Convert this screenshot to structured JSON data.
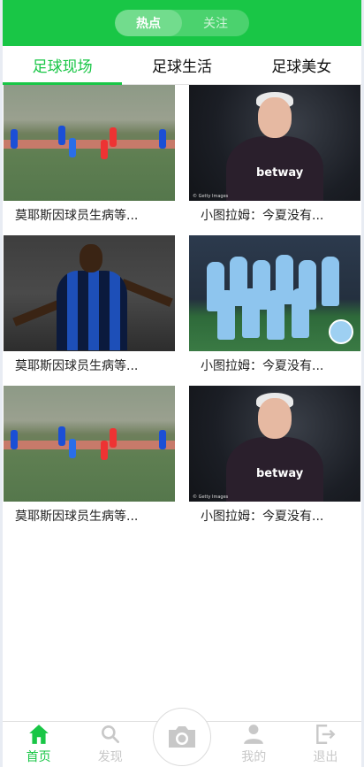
{
  "header": {
    "segments": [
      {
        "label": "热点",
        "active": true
      },
      {
        "label": "关注",
        "active": false
      }
    ],
    "background": "#19c646"
  },
  "tabs": [
    {
      "label": "足球现场",
      "active": true
    },
    {
      "label": "足球生活",
      "active": false
    },
    {
      "label": "足球美女",
      "active": false
    }
  ],
  "cards": [
    {
      "caption": "莫耶斯因球员生病等...",
      "image": "youth-football-match"
    },
    {
      "caption": "小图拉姆：今夏没有...",
      "image": "coach-portrait"
    },
    {
      "caption": "莫耶斯因球员生病等...",
      "image": "player-celebration"
    },
    {
      "caption": "小图拉姆：今夏没有...",
      "image": "team-photo"
    },
    {
      "caption": "莫耶斯因球员生病等...",
      "image": "youth-football-match"
    },
    {
      "caption": "小图拉姆：今夏没有...",
      "image": "coach-portrait"
    }
  ],
  "image_texts": {
    "betway": "betway",
    "credit": "© Getty Images"
  },
  "bottom_nav": [
    {
      "label": "首页",
      "icon": "home-icon",
      "active": true
    },
    {
      "label": "发现",
      "icon": "search-icon",
      "active": false
    },
    {
      "label": "",
      "icon": "camera-icon",
      "active": false
    },
    {
      "label": "我的",
      "icon": "user-icon",
      "active": false
    },
    {
      "label": "退出",
      "icon": "logout-icon",
      "active": false
    }
  ],
  "accent_color": "#19c646"
}
